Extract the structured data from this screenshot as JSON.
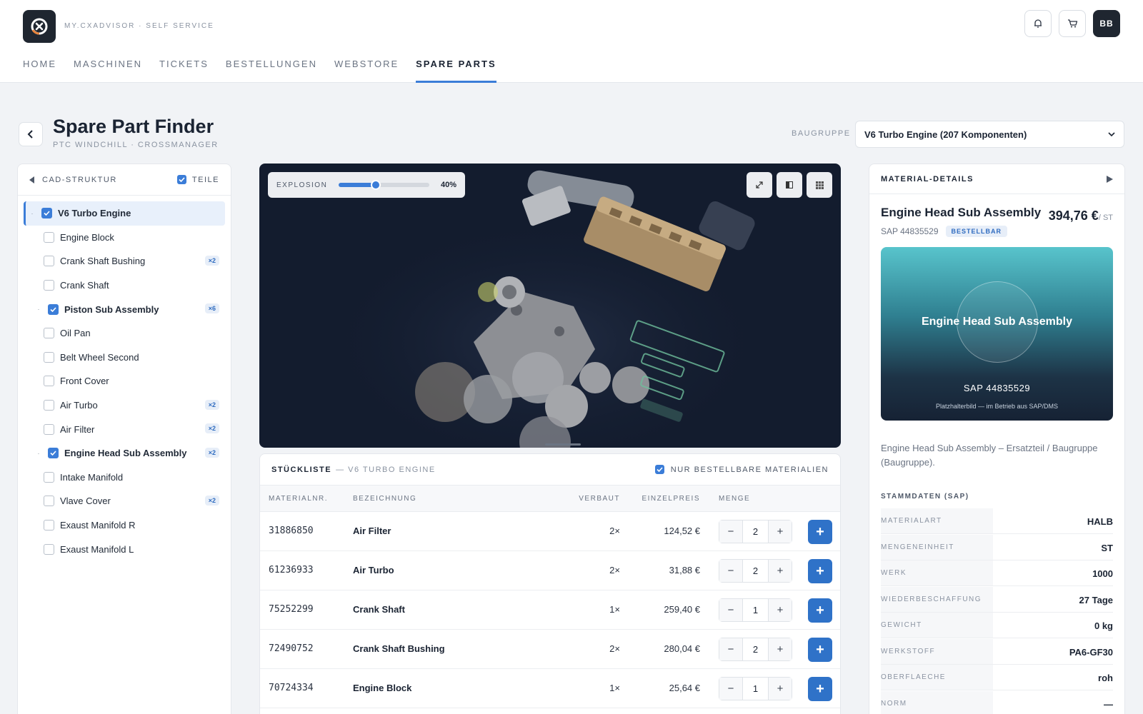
{
  "header": {
    "brand": "MY.CXADVISOR · SELF SERVICE",
    "nav": [
      "HOME",
      "MASCHINEN",
      "TICKETS",
      "BESTELLUNGEN",
      "WEBSTORE",
      "SPARE PARTS"
    ],
    "active_nav": "SPARE PARTS",
    "avatar": "BB"
  },
  "page": {
    "title": "Spare Part Finder",
    "subtitle": "PTC WINDCHILL · CROSSMANAGER",
    "baugruppe_label": "BAUGRUPPE",
    "baugruppe_value": "V6 Turbo Engine (207 Komponenten)"
  },
  "tree": {
    "title": "CAD-STRUKTUR",
    "teile_label": "TEILE",
    "items": [
      {
        "label": "V6 Turbo Engine",
        "checked": true,
        "root": true,
        "expander": "·",
        "count": ""
      },
      {
        "label": "Engine Block",
        "checked": false,
        "count": ""
      },
      {
        "label": "Crank Shaft Bushing",
        "checked": false,
        "count": "×2"
      },
      {
        "label": "Crank Shaft",
        "checked": false,
        "count": ""
      },
      {
        "label": "Piston Sub Assembly",
        "checked": true,
        "expander": "·",
        "count": "×6"
      },
      {
        "label": "Oil Pan",
        "checked": false,
        "count": ""
      },
      {
        "label": "Belt Wheel Second",
        "checked": false,
        "count": ""
      },
      {
        "label": "Front Cover",
        "checked": false,
        "count": ""
      },
      {
        "label": "Air Turbo",
        "checked": false,
        "count": "×2"
      },
      {
        "label": "Air Filter",
        "checked": false,
        "count": "×2"
      },
      {
        "label": "Engine Head Sub Assembly",
        "checked": true,
        "expander": "·",
        "count": "×2"
      },
      {
        "label": "Intake Manifold",
        "checked": false,
        "count": ""
      },
      {
        "label": "Vlave Cover",
        "checked": false,
        "count": "×2"
      },
      {
        "label": "Exaust Manifold R",
        "checked": false,
        "count": ""
      },
      {
        "label": "Exaust Manifold L",
        "checked": false,
        "count": ""
      }
    ]
  },
  "viewer": {
    "explosion_label": "EXPLOSION",
    "explosion_value": "40%",
    "explosion_fraction": 0.4
  },
  "parts_list": {
    "title": "STÜCKLISTE",
    "subtitle": "— V6 TURBO ENGINE",
    "only_orderable": "NUR BESTELLBARE MATERIALIEN",
    "columns": [
      "MATERIALNR.",
      "BEZEICHNUNG",
      "VERBAUT",
      "EINZELPREIS",
      "MENGE"
    ],
    "rows": [
      {
        "mat": "31886850",
        "name": "Air Filter",
        "installed": "2×",
        "price": "124,52 €",
        "qty": "2"
      },
      {
        "mat": "61236933",
        "name": "Air Turbo",
        "installed": "2×",
        "price": "31,88 €",
        "qty": "2"
      },
      {
        "mat": "75252299",
        "name": "Crank Shaft",
        "installed": "1×",
        "price": "259,40 €",
        "qty": "1"
      },
      {
        "mat": "72490752",
        "name": "Crank Shaft Bushing",
        "installed": "2×",
        "price": "280,04 €",
        "qty": "2"
      },
      {
        "mat": "70724334",
        "name": "Engine Block",
        "installed": "1×",
        "price": "25,64 €",
        "qty": "1"
      }
    ]
  },
  "details": {
    "title": "MATERIAL-DETAILS",
    "name": "Engine Head Sub Assembly",
    "price": "394,76 €",
    "unit": "/ ST",
    "sap": "SAP  44835529",
    "badge": "BESTELLBAR",
    "image_title": "Engine Head Sub Assembly",
    "image_sap": "SAP  44835529",
    "image_note": "Platzhalterbild — im Betrieb aus SAP/DMS",
    "description": "Engine Head Sub Assembly – Ersatzteil / Baugruppe (Baugruppe).",
    "section": "STAMMDATEN (SAP)",
    "fields": [
      {
        "k": "MATERIALART",
        "v": "HALB"
      },
      {
        "k": "MENGENEINHEIT",
        "v": "ST"
      },
      {
        "k": "WERK",
        "v": "1000"
      },
      {
        "k": "WIEDERBESCHAFFUNG",
        "v": "27 Tage"
      },
      {
        "k": "GEWICHT",
        "v": "0 kg"
      },
      {
        "k": "WERKSTOFF",
        "v": "PA6-GF30"
      },
      {
        "k": "OBERFLAECHE",
        "v": "roh"
      },
      {
        "k": "NORM",
        "v": "—"
      }
    ]
  },
  "colors": {
    "accent": "#3b7dd8",
    "viewer_bg": "#131c2e",
    "add_button": "#2f72c8"
  },
  "icons": [
    "bell-icon",
    "cart-icon",
    "chevron-left-icon",
    "chevron-down-icon",
    "fullscreen-icon",
    "section-icon",
    "grid-icon",
    "play-icon",
    "logo-icon"
  ]
}
